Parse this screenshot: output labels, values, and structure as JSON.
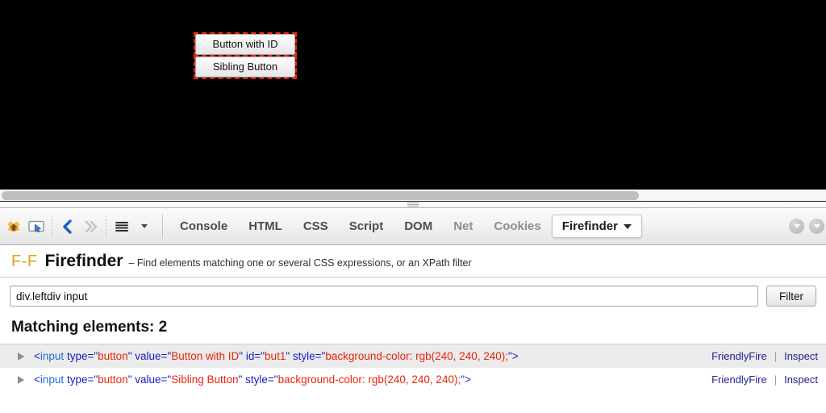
{
  "page": {
    "background_color": "#000000",
    "highlight_color": "#ff2200",
    "buttons": [
      {
        "label": "Button with ID"
      },
      {
        "label": "Sibling Button"
      }
    ]
  },
  "toolbar": {
    "icons": [
      {
        "name": "firebug-icon",
        "glyph": "🐞"
      },
      {
        "name": "inspect-element-icon",
        "glyph": "⬜"
      },
      {
        "name": "back-arrow-icon",
        "glyph": "❮"
      },
      {
        "name": "forward-arrow-icon",
        "glyph": "»"
      },
      {
        "name": "menu-lines-icon",
        "glyph": "☰"
      },
      {
        "name": "dropdown-caret-icon",
        "glyph": "▾"
      }
    ],
    "tabs": [
      {
        "label": "Console",
        "active": false,
        "dim": false
      },
      {
        "label": "HTML",
        "active": false,
        "dim": false
      },
      {
        "label": "CSS",
        "active": false,
        "dim": false
      },
      {
        "label": "Script",
        "active": false,
        "dim": false
      },
      {
        "label": "DOM",
        "active": false,
        "dim": false
      },
      {
        "label": "Net",
        "active": false,
        "dim": true
      },
      {
        "label": "Cookies",
        "active": false,
        "dim": true
      },
      {
        "label": "Firefinder",
        "active": true,
        "dim": false
      }
    ],
    "right_icons": [
      {
        "name": "minimize-panel-icon"
      },
      {
        "name": "close-panel-icon"
      }
    ]
  },
  "firefinder": {
    "logo": "F-F",
    "title": "Firefinder",
    "tagline": "– Find elements matching one or several CSS expressions, or an XPath filter",
    "logo_color": "#e0a321",
    "search": {
      "value": "div.leftdiv input",
      "placeholder": ""
    },
    "filter_button": "Filter",
    "matching_heading": "Matching elements: 2",
    "match_count": 2,
    "row_links": {
      "friendlyfire": "FriendlyFire",
      "separator": "|",
      "inspect": "Inspect"
    },
    "results": [
      {
        "open_bracket": "<",
        "tag": "input",
        "attrs": [
          {
            "name": "type",
            "value": "button"
          },
          {
            "name": "value",
            "value": "Button with ID"
          },
          {
            "name": "id",
            "value": "but1"
          },
          {
            "name": "style",
            "value": "background-color: rgb(240, 240, 240);"
          }
        ],
        "close_bracket": ">"
      },
      {
        "open_bracket": "<",
        "tag": "input",
        "attrs": [
          {
            "name": "type",
            "value": "button"
          },
          {
            "name": "value",
            "value": "Sibling Button"
          },
          {
            "name": "style",
            "value": "background-color: rgb(240, 240, 240);"
          }
        ],
        "close_bracket": ">"
      }
    ]
  }
}
